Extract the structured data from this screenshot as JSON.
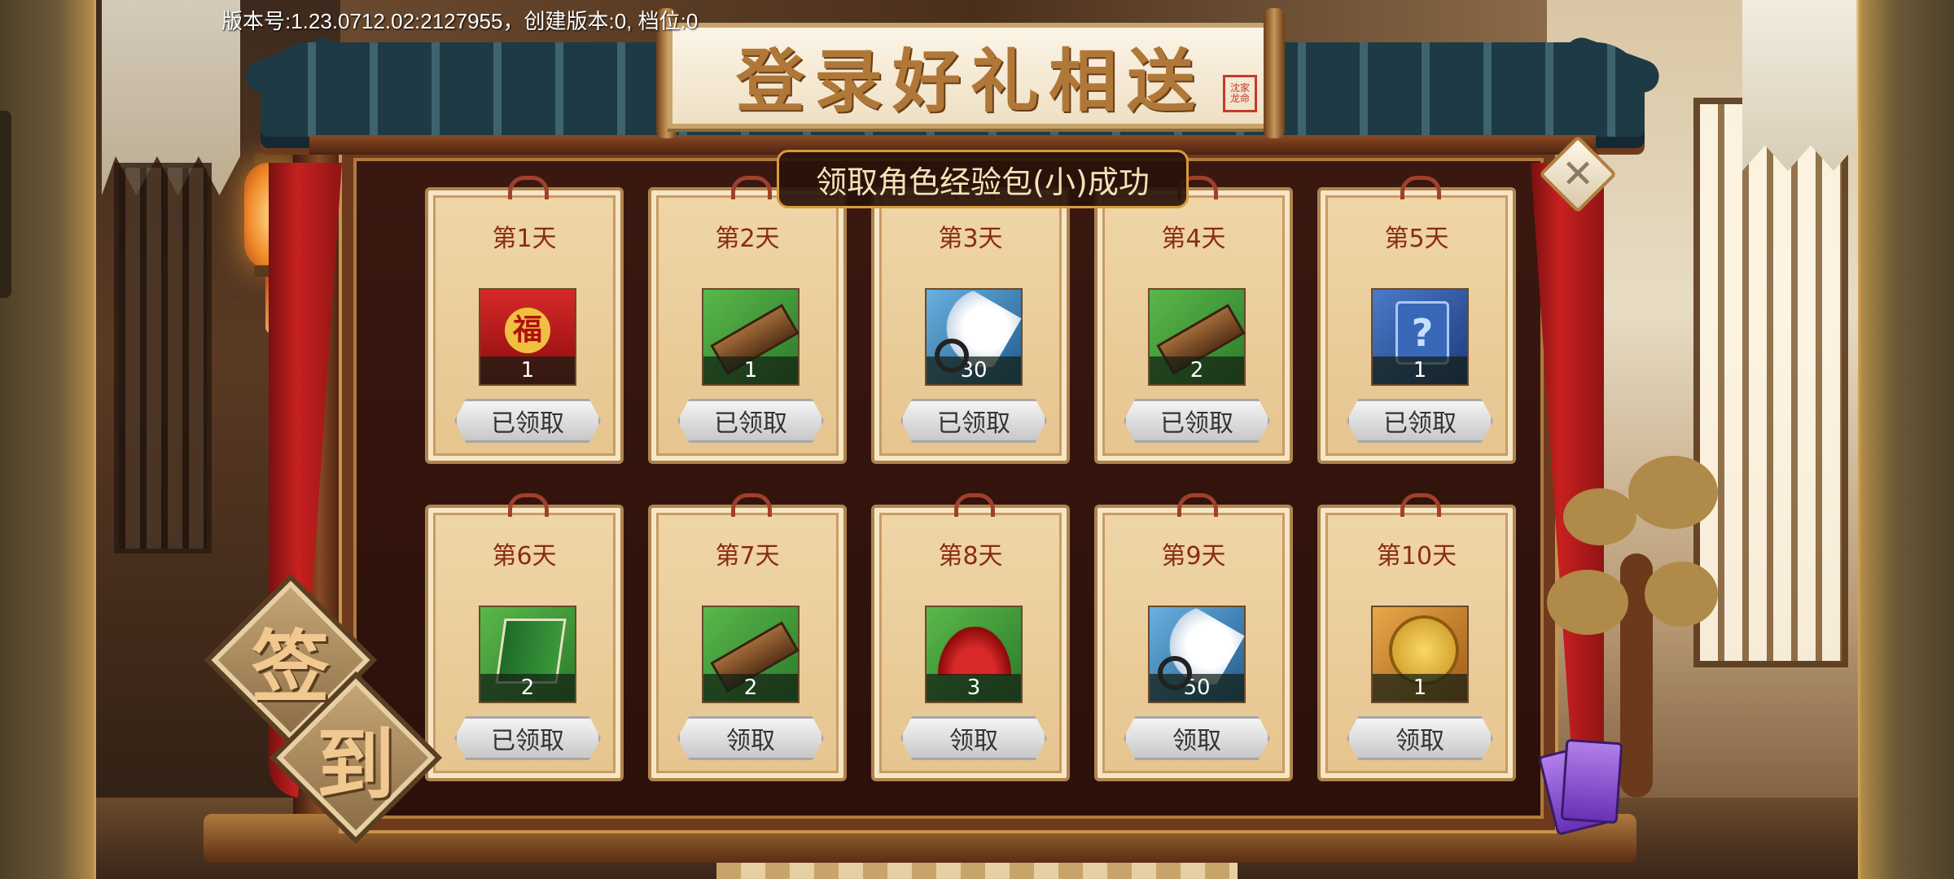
{
  "version_text": "版本号:1.23.0712.02:2127955，创建版本:0, 档位:0",
  "title": "登录好礼相送",
  "seal_text": "沈家龙命",
  "toast": "领取角色经验包(小)成功",
  "close_label": "✕",
  "badge": {
    "char1": "签",
    "char2": "到"
  },
  "days": [
    {
      "label": "第1天",
      "icon": "red-envelope-icon",
      "count": "1",
      "button": "已领取",
      "claimed": true
    },
    {
      "label": "第2天",
      "icon": "scroll-box-icon",
      "count": "1",
      "button": "已领取",
      "claimed": true
    },
    {
      "label": "第3天",
      "icon": "feather-fan-icon",
      "count": "30",
      "button": "已领取",
      "claimed": true
    },
    {
      "label": "第4天",
      "icon": "scroll-box-icon",
      "count": "2",
      "button": "已领取",
      "claimed": true
    },
    {
      "label": "第5天",
      "icon": "mystery-card-icon",
      "count": "1",
      "button": "已领取",
      "claimed": true
    },
    {
      "label": "第6天",
      "icon": "skill-book-icon",
      "count": "2",
      "button": "已领取",
      "claimed": true
    },
    {
      "label": "第7天",
      "icon": "scroll-box-icon",
      "count": "2",
      "button": "领取",
      "claimed": false
    },
    {
      "label": "第8天",
      "icon": "red-powder-icon",
      "count": "3",
      "button": "领取",
      "claimed": false
    },
    {
      "label": "第9天",
      "icon": "feather-fan-icon",
      "count": "50",
      "button": "领取",
      "claimed": false
    },
    {
      "label": "第10天",
      "icon": "gold-coin-icon",
      "count": "1",
      "button": "领取",
      "claimed": false
    }
  ],
  "colors": {
    "day_text": "#8a2a18",
    "toast_border": "#d89a3a",
    "title_text": "#b07838"
  }
}
